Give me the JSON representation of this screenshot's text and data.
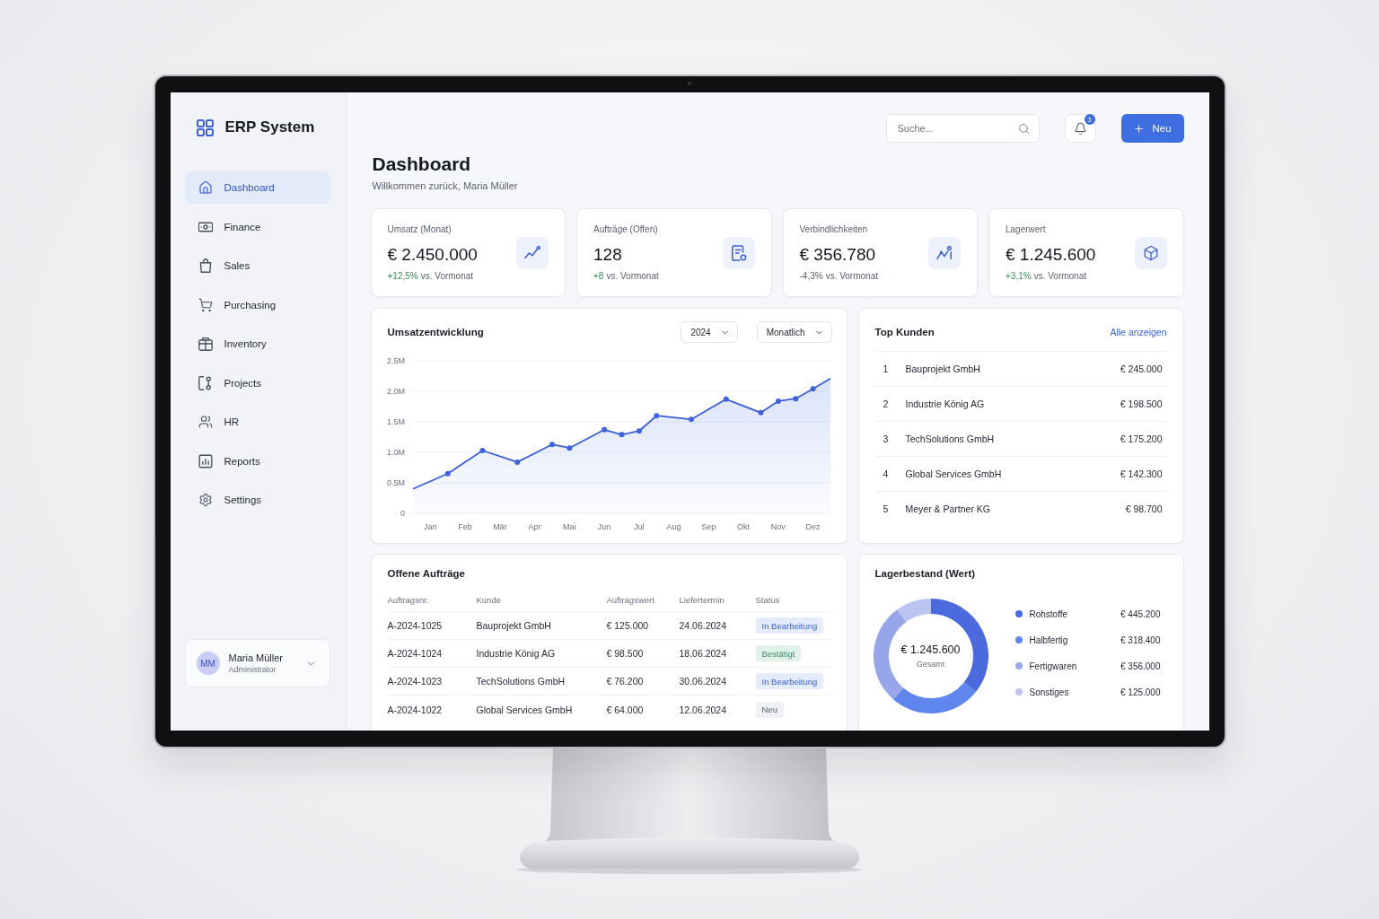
{
  "sidebar": {
    "app_name": "ERP System",
    "nav_items": [
      {
        "label": "Dashboard",
        "selected": true
      },
      {
        "label": "Finance",
        "selected": false
      },
      {
        "label": "Sales",
        "selected": false
      },
      {
        "label": "Purchasing",
        "selected": false
      },
      {
        "label": "Inventory",
        "selected": false
      },
      {
        "label": "Projects",
        "selected": false
      },
      {
        "label": "HR",
        "selected": false
      },
      {
        "label": "Reports",
        "selected": false
      },
      {
        "label": "Settings",
        "selected": false
      }
    ],
    "user": {
      "initials": "MM",
      "name": "Maria Müller",
      "role": "Administrator"
    }
  },
  "header": {
    "search": {
      "placeholder": "Suche..."
    },
    "notifications": {
      "count": "3"
    },
    "new_button": {
      "label": "Neu"
    }
  },
  "page": {
    "title": "Dashboard",
    "subtitle": "Willkommen zurück, Maria Müller"
  },
  "kpis": [
    {
      "label": "Umsatz (Monat)",
      "value": "€ 2.450.000",
      "delta": "+12,5%",
      "note": "vs. Vormonat",
      "positive": true
    },
    {
      "label": "Aufträge (Offen)",
      "value": "128",
      "delta": "+8",
      "note": "vs. Vormonat",
      "positive": true
    },
    {
      "label": "Verbindlichkeiten",
      "value": "€ 356.780",
      "delta": "-4,3%",
      "note": "vs. Vormonat",
      "positive": false
    },
    {
      "label": "Lagerwert",
      "value": "€ 1.245.600",
      "delta": "+3,1%",
      "note": "vs. Vormonat",
      "positive": true
    }
  ],
  "revenue": {
    "title": "Umsatzentwicklung",
    "year": "2024",
    "period": "Monatlich",
    "chart_data": {
      "type": "area",
      "grid": true,
      "categories": [
        null,
        "Jan",
        null,
        "Feb",
        null,
        "Mär",
        null,
        "Apr",
        null,
        "Mai",
        null,
        "Jun",
        null,
        "Jul",
        null,
        "Aug",
        null,
        "Sep",
        null,
        "Okt",
        null,
        "Nov",
        null,
        "Dez",
        null
      ],
      "values": [
        0.4,
        null,
        0.65,
        null,
        1.03,
        null,
        0.84,
        null,
        1.13,
        1.07,
        null,
        1.37,
        1.29,
        1.35,
        1.6,
        null,
        1.54,
        null,
        1.87,
        null,
        1.65,
        1.84,
        1.88,
        2.04,
        2.21
      ],
      "ylim": [
        0,
        2.5
      ],
      "yticks": [
        0,
        {
          "value": 0.5,
          "label": "0.5M"
        },
        {
          "value": 1,
          "label": "1.0M"
        },
        {
          "value": 1.5,
          "label": "1.5M"
        },
        {
          "value": 2,
          "label": "2.0M"
        },
        {
          "value": 2.5,
          "label": "2.5M"
        }
      ]
    }
  },
  "top_customers": {
    "title": "Top Kunden",
    "link": "Alle anzeigen",
    "rows": [
      {
        "rank": "1",
        "name": "Bauprojekt GmbH",
        "value": "€ 245.000"
      },
      {
        "rank": "2",
        "name": "Industrie König AG",
        "value": "€ 198.500"
      },
      {
        "rank": "3",
        "name": "TechSolutions GmbH",
        "value": "€ 175.200"
      },
      {
        "rank": "4",
        "name": "Global Services GmbH",
        "value": "€ 142.300"
      },
      {
        "rank": "5",
        "name": "Meyer & Partner KG",
        "value": "€ 98.700"
      }
    ]
  },
  "open_orders": {
    "title": "Offene Aufträge",
    "columns": [
      "Auftragsnr.",
      "Kunde",
      "Auftragswert",
      "Liefertermin",
      "Status"
    ],
    "rows": [
      {
        "order_no": "A-2024-1025",
        "customer": "Bauprojekt GmbH",
        "amount": "€ 125.000",
        "delivery_date": "24.06.2024",
        "status": {
          "label": "In Bearbeitung",
          "kind": "in_progress"
        }
      },
      {
        "order_no": "A-2024-1024",
        "customer": "Industrie König AG",
        "amount": "€ 98.500",
        "delivery_date": "18.06.2024",
        "status": {
          "label": "Bestätigt",
          "kind": "confirmed"
        }
      },
      {
        "order_no": "A-2024-1023",
        "customer": "TechSolutions GmbH",
        "amount": "€ 76.200",
        "delivery_date": "30.06.2024",
        "status": {
          "label": "In Bearbeitung",
          "kind": "in_progress"
        }
      },
      {
        "order_no": "A-2024-1022",
        "customer": "Global Services GmbH",
        "amount": "€ 64.000",
        "delivery_date": "12.06.2024",
        "status": {
          "label": "Neu",
          "kind": "new"
        }
      }
    ]
  },
  "inventory": {
    "title": "Lagerbestand (Wert)",
    "total": "€ 1.245.600",
    "total_label": "Gesamt",
    "items": [
      {
        "name": "Rohstoffe",
        "value": "€ 445.200",
        "color": "#4a6ade"
      },
      {
        "name": "Halbfertig",
        "value": "€ 318.400",
        "color": "#5f86ec"
      },
      {
        "name": "Fertigwaren",
        "value": "€ 356.000",
        "color": "#97a6e8"
      },
      {
        "name": "Sonstiges",
        "value": "€ 125.000",
        "color": "#bcc5f1"
      }
    ],
    "chart_data": {
      "type": "donut",
      "values": [
        35.77,
        25.58,
        28.61,
        10.04
      ]
    }
  }
}
